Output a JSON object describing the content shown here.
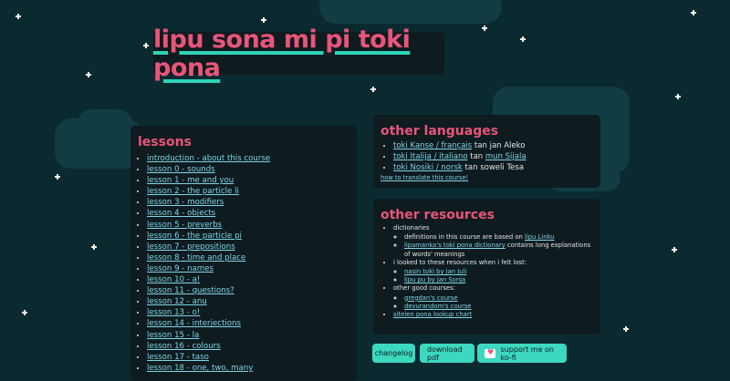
{
  "title": "lipu sona mi pi toki pona",
  "lessons": {
    "heading": "lessons",
    "items": [
      "introduction - about this course",
      "lesson 0 - sounds",
      "lesson 1 - me and you",
      "lesson 2 - the particle li",
      "lesson 3 - modifiers",
      "lesson 4 - objects",
      "lesson 5 - preverbs",
      "lesson 6 - the particle pi",
      "lesson 7 - prepositions",
      "lesson 8 - time and place",
      "lesson 9 - names",
      "lesson 10 - a!",
      "lesson 11 - questions?",
      "lesson 12 - anu",
      "lesson 13 - o!",
      "lesson 14 - interjections",
      "lesson 15 - la",
      "lesson 16 - colours",
      "lesson 17 - taso",
      "lesson 18 - one, two, many"
    ]
  },
  "other_languages": {
    "heading": "other languages",
    "items": [
      {
        "link": "toki Kanse / français",
        "sep": " tan ",
        "author": "jan Aleko"
      },
      {
        "link": "toki Italija / italiano",
        "sep": " tan ",
        "author_link": "mun Sijala"
      },
      {
        "link": "toki Nosiki / norsk",
        "sep": " tan ",
        "author": "soweli Tesa"
      }
    ],
    "howto": "how to translate this course!"
  },
  "resources": {
    "heading": "other resources",
    "dictionaries_label": "dictionaries",
    "dict1_pre": "definitions in this course are based on ",
    "dict1_link": "lipu Linku",
    "dict2_link": "lipamanka's toki pona dictionary",
    "dict2_post": " contains long explanations of words' meanings",
    "looked_label": "i looked to these resources when i felt lost:",
    "looked1": "nasin toki by jan Juli",
    "looked2": "lipu pu by jan Sonja",
    "good_label": "other good courses:",
    "good1": "gregdan's course",
    "good2": "devurandom's course",
    "sitelen": "sitelen pona lookup chart"
  },
  "buttons": {
    "changelog": "changelog",
    "download": "download pdf",
    "kofi": "support me on ko-fi"
  },
  "colors": {
    "background": "#0a2a30",
    "panel": "#0e1b1f",
    "accent_pink": "#e9557a",
    "accent_teal": "#3cd8c0",
    "link": "#7fd4e8"
  }
}
